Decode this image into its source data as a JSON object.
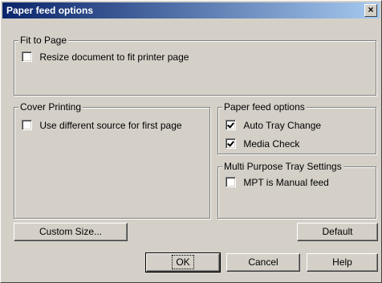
{
  "window": {
    "title": "Paper feed options",
    "close_glyph": "×"
  },
  "fit_to_page": {
    "legend": "Fit to Page",
    "resize_label": "Resize document to fit printer page",
    "resize_checked": false
  },
  "cover_printing": {
    "legend": "Cover Printing",
    "different_source_label": "Use different source for first page",
    "different_source_checked": false
  },
  "paper_feed": {
    "legend": "Paper feed options",
    "auto_tray_label": "Auto Tray Change",
    "auto_tray_checked": true,
    "media_check_label": "Media Check",
    "media_check_checked": true
  },
  "mpt": {
    "legend": "Multi Purpose Tray Settings",
    "manual_feed_label": "MPT is Manual feed",
    "manual_feed_checked": false
  },
  "buttons": {
    "custom_size": "Custom Size...",
    "default": "Default",
    "ok": "OK",
    "cancel": "Cancel",
    "help": "Help"
  }
}
